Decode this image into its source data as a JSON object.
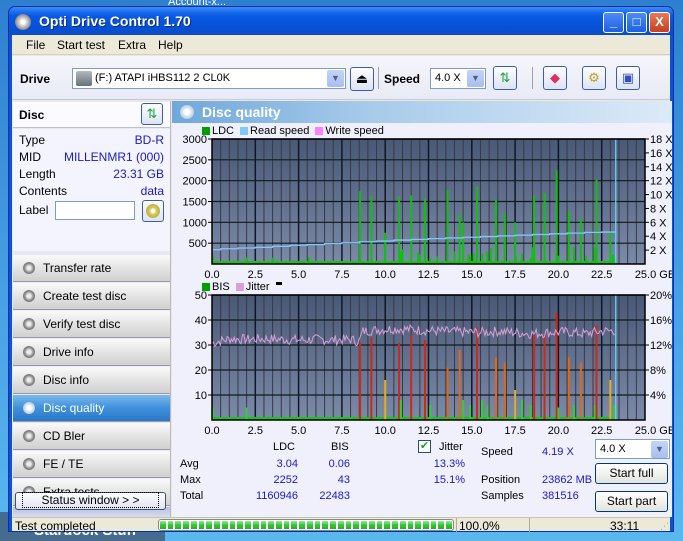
{
  "desktop": {
    "top_label": "Account-x...",
    "bottom_label": "Stardock Stuff"
  },
  "window": {
    "title": "Opti Drive Control 1.70",
    "buttons": {
      "minimize": "_",
      "maximize": "□",
      "close": "X"
    }
  },
  "menu": [
    {
      "label": "File",
      "accel": "F"
    },
    {
      "label": "Start test",
      "accel": "S"
    },
    {
      "label": "Extra",
      "accel": "t"
    },
    {
      "label": "Help",
      "accel": "H"
    }
  ],
  "toolbar": {
    "drive_label": "Drive",
    "drive_value": "(F:)  ATAPI iHBS112   2 CL0K",
    "speed_label": "Speed",
    "speed_value": "4.0 X",
    "eject_icon": "eject-icon",
    "refresh_icon": "refresh-icon",
    "erase_icon": "eraser-icon",
    "settings_icon": "gears-icon",
    "save_icon": "floppy-icon"
  },
  "disc": {
    "header": "Disc",
    "fields": [
      {
        "key": "Type",
        "value": "BD-R"
      },
      {
        "key": "MID",
        "value": "MILLENMR1 (000)"
      },
      {
        "key": "Length",
        "value": "23.31 GB"
      },
      {
        "key": "Contents",
        "value": "data"
      }
    ],
    "label_key": "Label",
    "label_value": ""
  },
  "nav": [
    {
      "label": "Transfer rate",
      "active": false
    },
    {
      "label": "Create test disc",
      "active": false
    },
    {
      "label": "Verify test disc",
      "active": false
    },
    {
      "label": "Drive info",
      "active": false
    },
    {
      "label": "Disc info",
      "active": false
    },
    {
      "label": "Disc quality",
      "active": true
    },
    {
      "label": "CD Bler",
      "active": false
    },
    {
      "label": "FE / TE",
      "active": false
    },
    {
      "label": "Extra tests",
      "active": false
    }
  ],
  "status_window_button": "Status window > >",
  "panel": {
    "title": "Disc quality"
  },
  "colors": {
    "ldc": "#00a000",
    "read_speed": "#80c8f8",
    "write_speed": "#ff80ff",
    "bis": "#00a000",
    "jitter": "#d8a0d8",
    "plot_bg_top": "#4a5878",
    "plot_bg_bottom": "#7a8aa8",
    "accent_link": "#1818d0"
  },
  "chart_data": [
    {
      "type": "bar",
      "title": "LDC / Read speed",
      "legend": [
        "LDC",
        "Read speed",
        "Write speed"
      ],
      "legend_position": "top-left",
      "xlabel": "GB",
      "xlim": [
        0,
        25
      ],
      "x_ticks": [
        "0.0",
        "2.5",
        "5.0",
        "7.5",
        "10.0",
        "12.5",
        "15.0",
        "17.5",
        "20.0",
        "22.5",
        "25.0 GB"
      ],
      "ylim_left": [
        0,
        3000
      ],
      "y_ticks_left": [
        "500",
        "1000",
        "1500",
        "2000",
        "2500",
        "3000"
      ],
      "ylim_right": [
        0,
        18
      ],
      "y_ticks_right": [
        "2 X",
        "4 X",
        "6 X",
        "8 X",
        "10 X",
        "12 X",
        "14 X",
        "16 X",
        "18 X"
      ],
      "grid": true,
      "end_marker_gb": 23.31,
      "series": [
        {
          "name": "LDC",
          "axis": "left",
          "points": [
            [
              0.05,
              200
            ],
            [
              1.0,
              40
            ],
            [
              2.0,
              160
            ],
            [
              3.5,
              150
            ],
            [
              5.6,
              170
            ],
            [
              7.0,
              50
            ],
            [
              8.55,
              1750
            ],
            [
              9.2,
              1620
            ],
            [
              10.0,
              750
            ],
            [
              10.8,
              1620
            ],
            [
              10.9,
              310
            ],
            [
              11.0,
              350
            ],
            [
              11.5,
              1650
            ],
            [
              11.9,
              270
            ],
            [
              12.0,
              230
            ],
            [
              12.3,
              1560
            ],
            [
              12.6,
              150
            ],
            [
              13.0,
              180
            ],
            [
              13.6,
              1780
            ],
            [
              14.0,
              300
            ],
            [
              14.3,
              1200
            ],
            [
              14.5,
              1000
            ],
            [
              14.8,
              230
            ],
            [
              14.9,
              200
            ],
            [
              15.1,
              250
            ],
            [
              15.3,
              1850
            ],
            [
              15.6,
              250
            ],
            [
              15.9,
              300
            ],
            [
              16.1,
              380
            ],
            [
              16.4,
              1550
            ],
            [
              16.9,
              1200
            ],
            [
              17.5,
              1000
            ],
            [
              17.55,
              180
            ],
            [
              17.9,
              250
            ],
            [
              18.4,
              130
            ],
            [
              18.5,
              400
            ],
            [
              18.6,
              1650
            ],
            [
              19.2,
              1700
            ],
            [
              19.9,
              2250
            ],
            [
              20.0,
              200
            ],
            [
              20.6,
              1250
            ],
            [
              20.9,
              400
            ],
            [
              21.3,
              1100
            ],
            [
              21.6,
              200
            ],
            [
              22.1,
              400
            ],
            [
              22.2,
              2030
            ],
            [
              23.0,
              750
            ],
            [
              23.15,
              220
            ],
            [
              23.3,
              150
            ]
          ]
        },
        {
          "name": "Read speed",
          "axis": "right",
          "points": [
            [
              0,
              2.05
            ],
            [
              0.5,
              2.2
            ],
            [
              1.5,
              2.3
            ],
            [
              2.5,
              2.4
            ],
            [
              3.5,
              2.55
            ],
            [
              4.5,
              2.7
            ],
            [
              5.5,
              2.8
            ],
            [
              6.5,
              2.95
            ],
            [
              7.5,
              3.05
            ],
            [
              8.5,
              3.2
            ],
            [
              9.5,
              3.3
            ],
            [
              10.5,
              3.45
            ],
            [
              11.5,
              3.55
            ],
            [
              12.5,
              3.65
            ],
            [
              13.5,
              3.75
            ],
            [
              14.5,
              3.85
            ],
            [
              15.5,
              3.95
            ],
            [
              16.5,
              4.05
            ],
            [
              17.5,
              4.15
            ],
            [
              18.5,
              4.25
            ],
            [
              19.5,
              4.35
            ],
            [
              20.5,
              4.45
            ],
            [
              21.5,
              4.55
            ],
            [
              22.5,
              4.6
            ],
            [
              23.31,
              4.75
            ]
          ]
        },
        {
          "name": "Write speed",
          "axis": "right",
          "points": []
        }
      ]
    },
    {
      "type": "bar",
      "title": "BIS / Jitter",
      "legend": [
        "BIS",
        "Jitter"
      ],
      "legend_position": "top-left",
      "xlabel": "GB",
      "xlim": [
        0,
        25
      ],
      "x_ticks": [
        "0.0",
        "2.5",
        "5.0",
        "7.5",
        "10.0",
        "12.5",
        "15.0",
        "17.5",
        "20.0",
        "22.5",
        "25.0 GB"
      ],
      "ylim_left": [
        0,
        50
      ],
      "y_ticks_left": [
        "10",
        "20",
        "30",
        "40",
        "50"
      ],
      "ylim_right": [
        0,
        20
      ],
      "y_ticks_right": [
        "4%",
        "8%",
        "12%",
        "16%",
        "20%"
      ],
      "grid": true,
      "end_marker_gb": 23.31,
      "series": [
        {
          "name": "BIS",
          "axis": "left",
          "points": [
            [
              0.05,
              5
            ],
            [
              2.0,
              5
            ],
            [
              8.55,
              31
            ],
            [
              9.2,
              33
            ],
            [
              10.0,
              16
            ],
            [
              10.8,
              31
            ],
            [
              10.9,
              8
            ],
            [
              11.5,
              34
            ],
            [
              12.3,
              32
            ],
            [
              12.6,
              6
            ],
            [
              13.6,
              21
            ],
            [
              14.3,
              28
            ],
            [
              14.5,
              8
            ],
            [
              14.9,
              6
            ],
            [
              15.3,
              37
            ],
            [
              15.6,
              8
            ],
            [
              15.9,
              6
            ],
            [
              16.4,
              25
            ],
            [
              16.9,
              23
            ],
            [
              17.5,
              12
            ],
            [
              17.9,
              8
            ],
            [
              18.4,
              6
            ],
            [
              18.6,
              34
            ],
            [
              19.2,
              34
            ],
            [
              19.9,
              43
            ],
            [
              20.0,
              5
            ],
            [
              20.6,
              25
            ],
            [
              20.9,
              6
            ],
            [
              21.3,
              23
            ],
            [
              22.1,
              6
            ],
            [
              22.2,
              38
            ],
            [
              23.0,
              16
            ],
            [
              23.2,
              6
            ]
          ]
        },
        {
          "name": "Jitter",
          "axis": "right",
          "avg_pct": 13.3,
          "max_pct": 15.1,
          "points": [
            [
              0,
              12.3
            ],
            [
              1.0,
              13.0
            ],
            [
              2.0,
              12.9
            ],
            [
              3.0,
              13.0
            ],
            [
              4.0,
              12.9
            ],
            [
              5.0,
              12.8
            ],
            [
              6.0,
              12.9
            ],
            [
              7.0,
              12.8
            ],
            [
              8.0,
              12.9
            ],
            [
              8.5,
              12.5
            ],
            [
              8.7,
              14.2
            ],
            [
              9.5,
              14.4
            ],
            [
              10.5,
              14.6
            ],
            [
              11.5,
              14.5
            ],
            [
              12.5,
              14.3
            ],
            [
              13.5,
              14.2
            ],
            [
              14.5,
              14.1
            ],
            [
              15.5,
              14.0
            ],
            [
              16.5,
              14.2
            ],
            [
              17.5,
              14.0
            ],
            [
              18.5,
              13.8
            ],
            [
              19.5,
              14.0
            ],
            [
              20.5,
              14.1
            ],
            [
              21.5,
              13.8
            ],
            [
              22.5,
              14.2
            ],
            [
              23.31,
              14.3
            ]
          ]
        }
      ]
    }
  ],
  "stats": {
    "col_ldc": "LDC",
    "col_bis": "BIS",
    "jitter_label": "Jitter",
    "jitter_checked": true,
    "rows": [
      {
        "label": "Avg",
        "ldc": "3.04",
        "bis": "0.06",
        "jitter": "13.3%"
      },
      {
        "label": "Max",
        "ldc": "2252",
        "bis": "43",
        "jitter": "15.1%"
      },
      {
        "label": "Total",
        "ldc": "1160946",
        "bis": "22483",
        "jitter": ""
      }
    ],
    "speed_label": "Speed",
    "speed_value": "4.19 X",
    "position_label": "Position",
    "position_value": "23862 MB",
    "samples_label": "Samples",
    "samples_value": "381516",
    "speed_select": "4.0 X",
    "start_full": "Start full",
    "start_part": "Start part"
  },
  "statusbar": {
    "text": "Test completed",
    "progress_pct": 100.0,
    "progress_text": "100.0%",
    "elapsed": "33:11"
  }
}
